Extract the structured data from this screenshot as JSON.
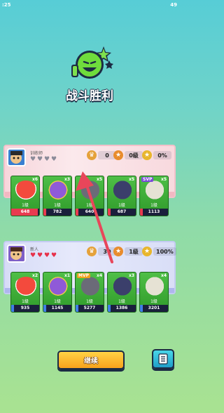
{
  "status_bar": {
    "time": ":25",
    "battery": "49"
  },
  "title": "战斗胜利",
  "enemy": {
    "name": "训练师",
    "hearts_total": 4,
    "hearts_remaining": 0,
    "stats": {
      "kills": "0",
      "level": "0级",
      "percent": "0%"
    },
    "cards": [
      {
        "count": "x6",
        "level": "1级",
        "value": "648",
        "fill": 0.95,
        "color": "green"
      },
      {
        "count": "x3",
        "level": "1级",
        "value": "782",
        "fill": 0.1,
        "color": "green"
      },
      {
        "count": "x5",
        "level": "1级",
        "value": "640",
        "fill": 0.1,
        "color": "green"
      },
      {
        "count": "x5",
        "level": "1级",
        "value": "687",
        "fill": 0.1,
        "color": "green"
      },
      {
        "count": "x5",
        "level": "1级",
        "value": "1113",
        "fill": 0.1,
        "color": "green",
        "badge": "SVP"
      }
    ]
  },
  "player": {
    "name": "新人",
    "hearts_total": 4,
    "hearts_remaining": 4,
    "stats": {
      "kills": "30",
      "level": "1级",
      "percent": "100%"
    },
    "cards": [
      {
        "count": "x2",
        "level": "1级",
        "value": "935",
        "fill": 0.1,
        "color": "green"
      },
      {
        "count": "x1",
        "level": "1级",
        "value": "1145",
        "fill": 0.1,
        "color": "green"
      },
      {
        "count": "x4",
        "level": "1级",
        "value": "5277",
        "fill": 0.1,
        "color": "green",
        "badge": "MVP"
      },
      {
        "count": "x3",
        "level": "1级",
        "value": "1386",
        "fill": 0.1,
        "color": "green"
      },
      {
        "count": "x4",
        "level": "1级",
        "value": "3201",
        "fill": 0.1,
        "color": "green"
      }
    ]
  },
  "buttons": {
    "continue": "继续"
  },
  "colors": {
    "accent_orange": "#f8a21c",
    "enemy_red": "#e93a50",
    "player_blue": "#3f7fe8"
  }
}
